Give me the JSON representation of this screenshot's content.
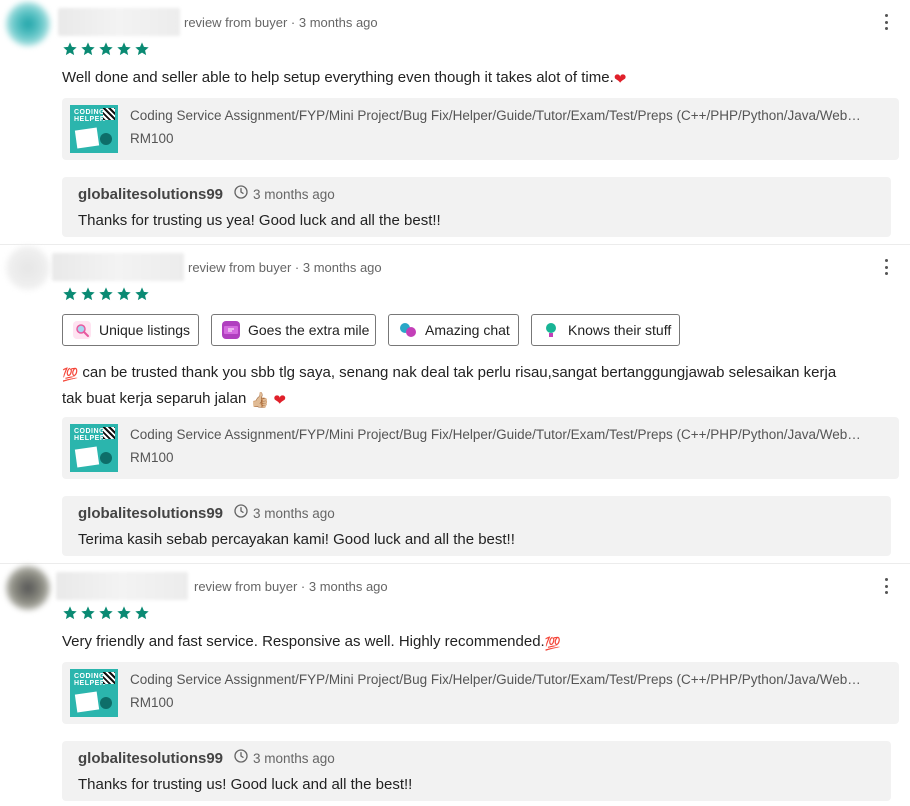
{
  "reviews": [
    {
      "meta": "review from buyer · 3 months ago",
      "rating": 5,
      "text": "Well done and seller able to help setup everything even though it takes alot of time.",
      "text_emoji": "❤",
      "product": {
        "title": "Coding Service Assignment/FYP/Mini Project/Bug Fix/Helper/Guide/Tutor/Exam/Test/Preps (C++/PHP/Python/Java/Web…",
        "price": "RM100",
        "thumb_text": "CODING HELPER"
      },
      "reply": {
        "name": "globalitesolutions99",
        "time": "3 months ago",
        "text": "Thanks for trusting us yea! Good luck and all the best!!"
      }
    },
    {
      "meta": "review from buyer · 3 months ago",
      "rating": 5,
      "tags": [
        "Unique listings",
        "Goes the extra mile",
        "Amazing chat",
        "Knows their stuff"
      ],
      "text_line1": "can be trusted thank you sbb tlg saya, senang nak deal tak perlu risau,sangat bertanggungjawab selesaikan kerja",
      "text_line2": "tak buat kerja separuh jalan",
      "text_emoji_lead": "💯",
      "text_emoji_tail": "👍🏼 ❤",
      "product": {
        "title": "Coding Service Assignment/FYP/Mini Project/Bug Fix/Helper/Guide/Tutor/Exam/Test/Preps (C++/PHP/Python/Java/Web…",
        "price": "RM100",
        "thumb_text": "CODING HELPER"
      },
      "reply": {
        "name": "globalitesolutions99",
        "time": "3 months ago",
        "text": "Terima kasih sebab percayakan kami! Good luck and all the best!!"
      }
    },
    {
      "meta": "review from buyer · 3 months ago",
      "rating": 5,
      "text": "Very friendly and fast service. Responsive as well. Highly recommended.",
      "text_emoji": "💯",
      "product": {
        "title": "Coding Service Assignment/FYP/Mini Project/Bug Fix/Helper/Guide/Tutor/Exam/Test/Preps (C++/PHP/Python/Java/Web…",
        "price": "RM100",
        "thumb_text": "CODING HELPER"
      },
      "reply": {
        "name": "globalitesolutions99",
        "time": "3 months ago",
        "text": "Thanks for trusting us! Good luck and all the best!!"
      }
    }
  ],
  "colors": {
    "star": "#0a8a73",
    "heart": "#e0202a",
    "hundred": "#e0202a"
  },
  "icons": {
    "star": "star-icon",
    "clock": "clock-icon",
    "more": "more-vertical-icon"
  }
}
